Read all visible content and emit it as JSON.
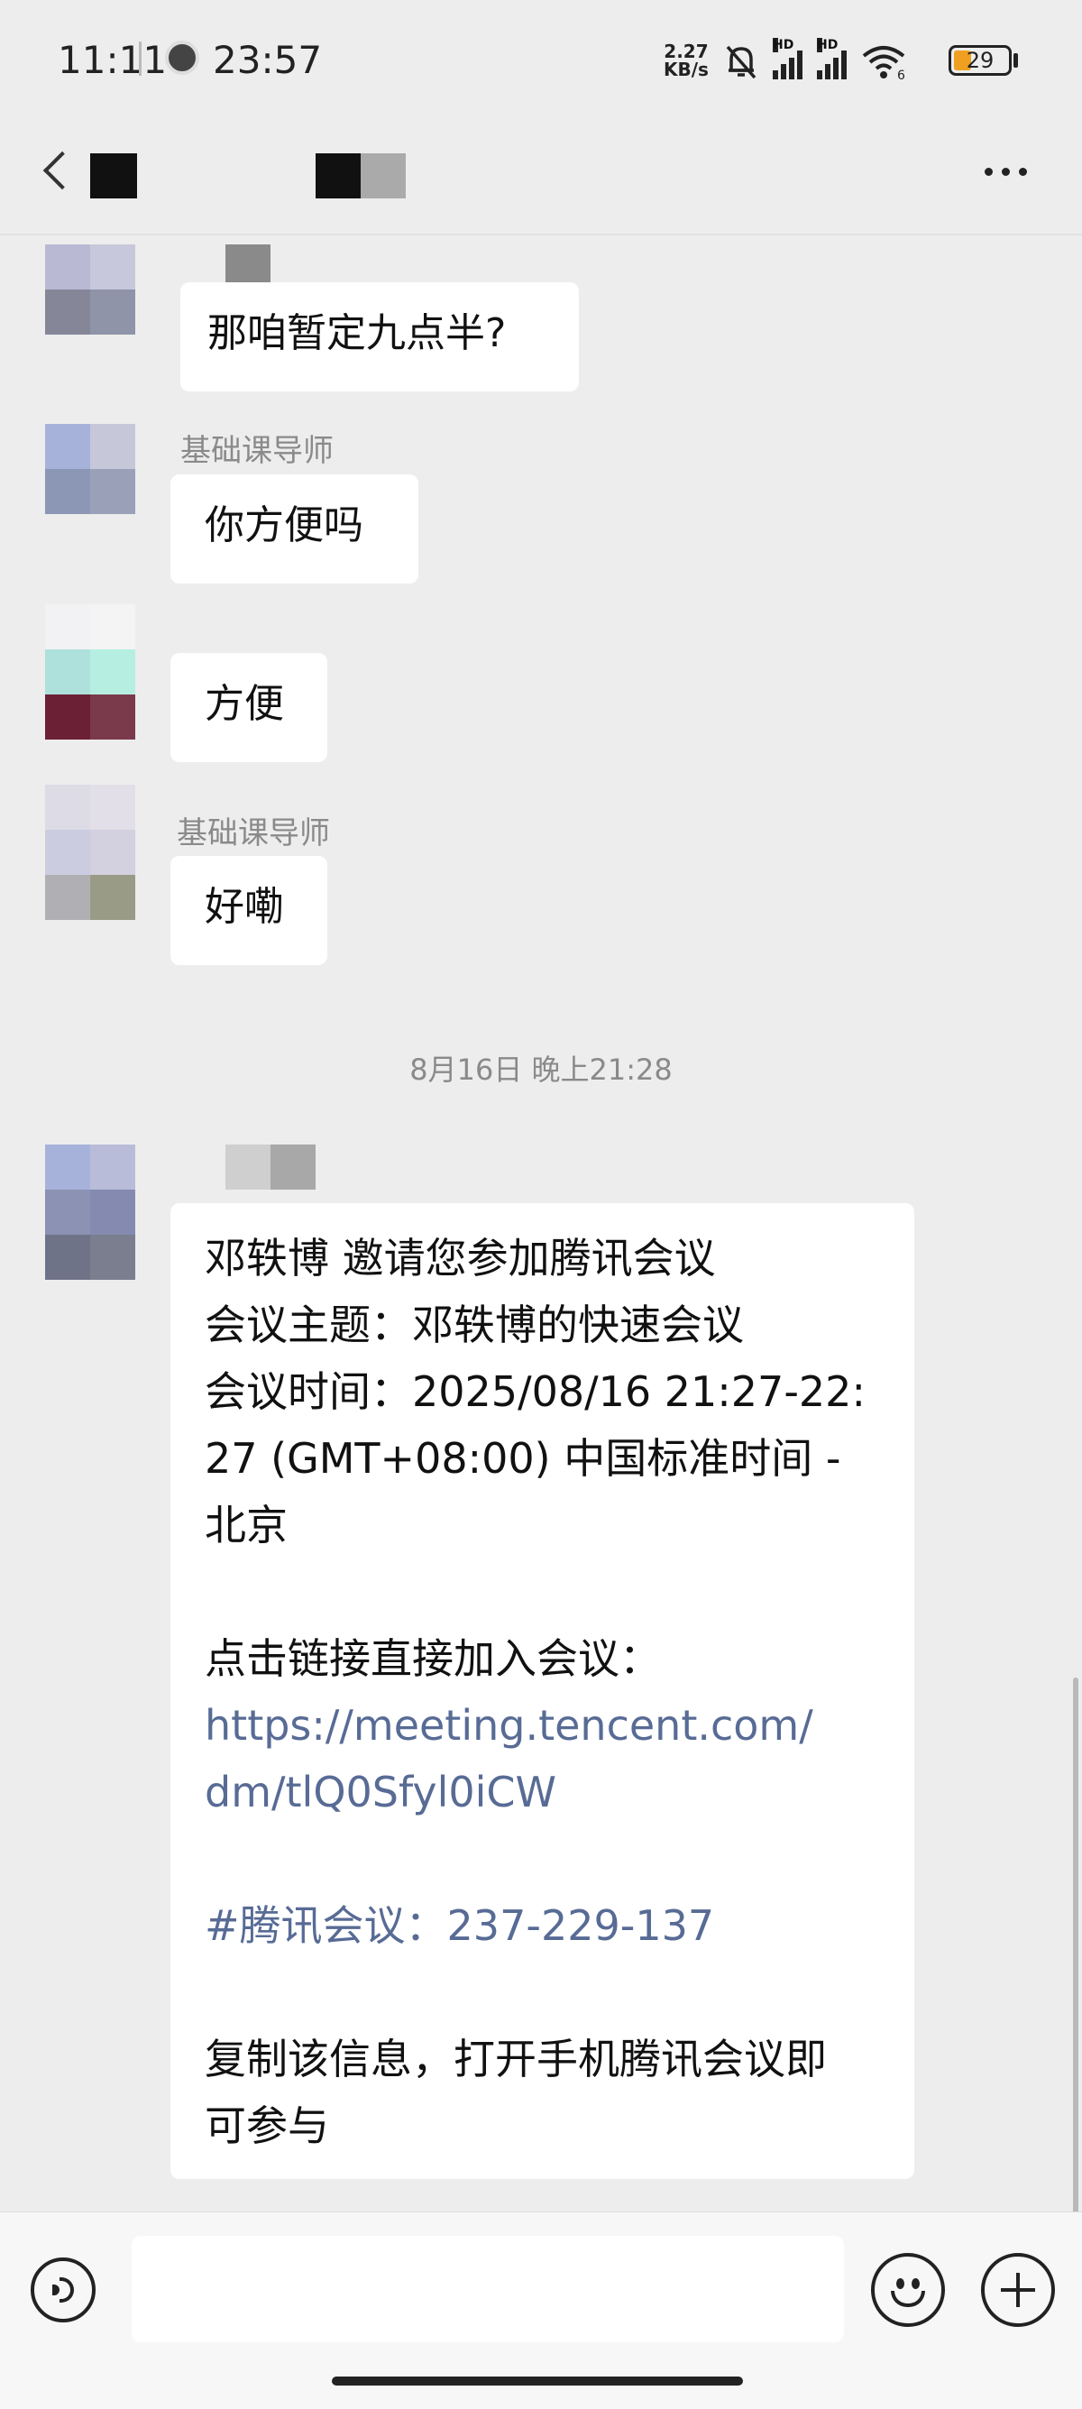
{
  "status_bar": {
    "time": "11:11",
    "clock_time": "23:57",
    "net_speed_value": "2.27",
    "net_speed_unit": "KB/s",
    "signal_label": "HD",
    "wifi_label": "6",
    "battery_percent": "29"
  },
  "messages": [
    {
      "type": "text",
      "text": "那咱暂定九点半?"
    },
    {
      "type": "text",
      "sender": "基础课导师",
      "text": "你方便吗"
    },
    {
      "type": "text",
      "text": "方便"
    },
    {
      "type": "text",
      "sender": "基础课导师",
      "text": "好嘞"
    }
  ],
  "timestamp": "8月16日 晚上21:28",
  "meeting_message": {
    "line1": "邓轶博 邀请您参加腾讯会议",
    "line2": "会议主题：邓轶博的快速会议",
    "line3": "会议时间：2025/08/16 21:27-22:",
    "line4": "27 (GMT+08:00) 中国标准时间 -",
    "line5": "北京",
    "line6": "点击链接直接加入会议：",
    "link_line1": "https://meeting.tencent.com/",
    "link_line2": "dm/tlQ0Sfyl0iCW",
    "meeting_id": "#腾讯会议：237-229-137",
    "line7": "复制该信息，打开手机腾讯会议即",
    "line8": "可参与"
  },
  "input": {
    "placeholder": "",
    "value": ""
  },
  "colors": {
    "background": "#ededed",
    "bubble": "#ffffff",
    "link": "#576b95",
    "battery_fill": "#f0a020"
  }
}
